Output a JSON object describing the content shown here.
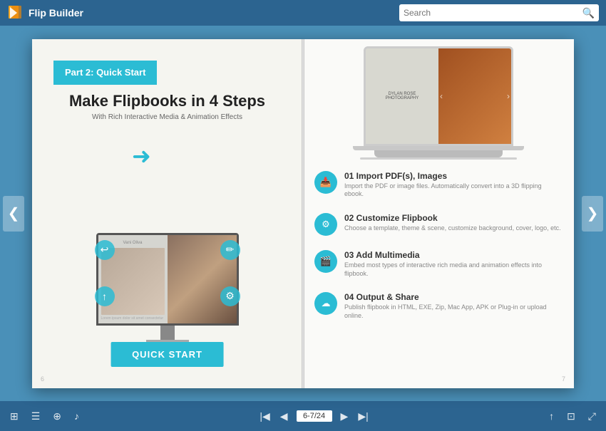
{
  "header": {
    "logo_text": "Flip Builder",
    "search_placeholder": "Search"
  },
  "nav": {
    "left_arrow": "❮",
    "right_arrow": "❯"
  },
  "left_page": {
    "part_label": "Part 2: Quick Start",
    "title": "Make Flipbooks in 4 Steps",
    "subtitle": "With Rich Interactive Media & Animation Effects",
    "quick_start_btn": "QUICK START"
  },
  "right_page": {
    "laptop_left_text": "DYLAN ROSE\nPHOTOGRAPHY",
    "steps": [
      {
        "number": "01",
        "title": "Import PDF(s), Images",
        "desc": "Import the PDF or image files. Automatically convert into a 3D flipping ebook."
      },
      {
        "number": "02",
        "title": "Customize Flipbook",
        "desc": "Choose a template, theme & scene, customize background, cover, logo, etc."
      },
      {
        "number": "03",
        "title": "Add Multimedia",
        "desc": "Embed most types of interactive rich media and animation effects into flipbook."
      },
      {
        "number": "04",
        "title": "Output & Share",
        "desc": "Publish flipbook in HTML, EXE, Zip, Mac App, APK or Plug-in or upload online."
      }
    ]
  },
  "toolbar": {
    "page_indicator": "6-7/24",
    "icons": {
      "grid": "⊞",
      "list": "☰",
      "zoom": "⊕",
      "sound": "♪",
      "first": "|◀",
      "prev": "◀",
      "next": "▶",
      "last": "▶|",
      "share": "↑",
      "bookmark": "⊡",
      "fullscreen": "⤢"
    }
  }
}
